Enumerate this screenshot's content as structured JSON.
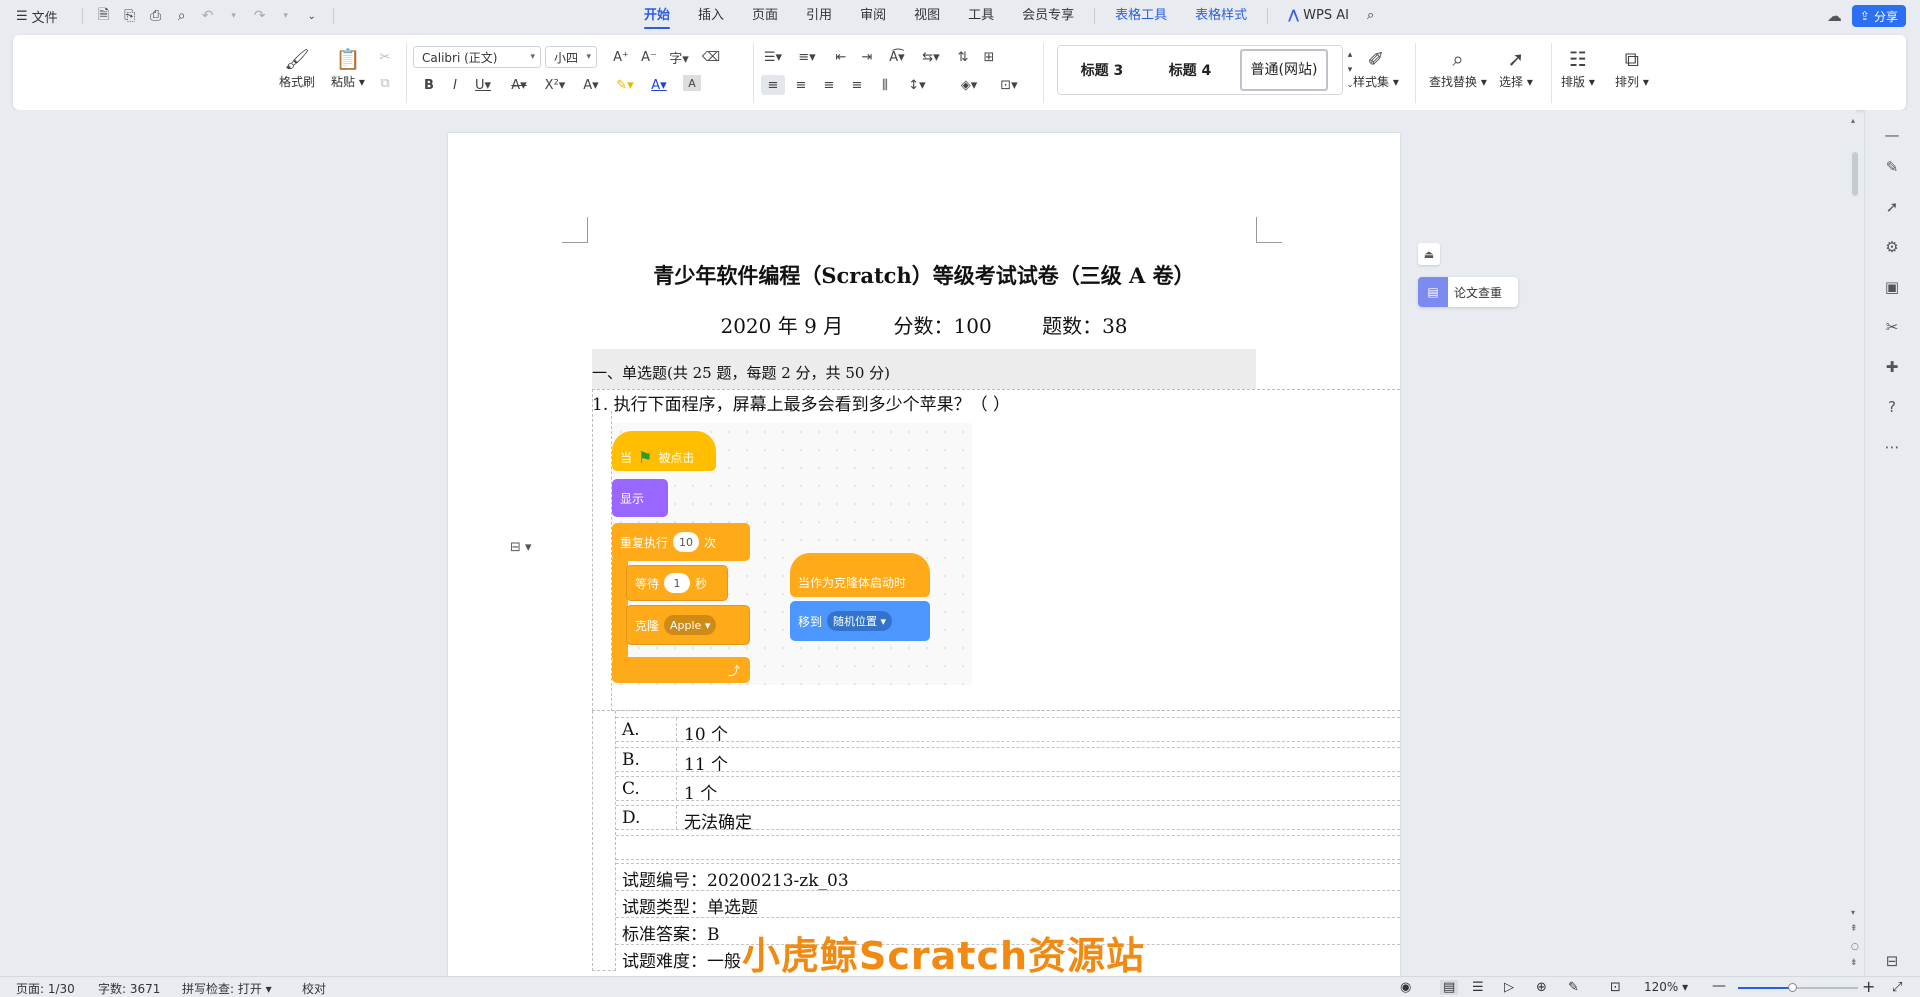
{
  "titlebar": {
    "file_label": "文件",
    "tabs": [
      {
        "label": "开始",
        "active": true
      },
      {
        "label": "插入"
      },
      {
        "label": "页面"
      },
      {
        "label": "引用"
      },
      {
        "label": "审阅"
      },
      {
        "label": "视图"
      },
      {
        "label": "工具"
      },
      {
        "label": "会员专享"
      },
      {
        "label": "表格工具",
        "contextual": true
      },
      {
        "label": "表格样式",
        "contextual": true
      }
    ],
    "wps_ai": "WPS AI",
    "share": "分享"
  },
  "ribbon": {
    "format_painter": "格式刷",
    "paste": "粘贴",
    "font_name": "Calibri (正文)",
    "font_size": "小四",
    "styles": [
      "标题 3",
      "标题 4",
      "普通(网站)"
    ],
    "style_set": "样式集",
    "find_replace": "查找替换",
    "select": "选择",
    "layout": "排版",
    "arrange": "排列"
  },
  "document": {
    "title": "青少年软件编程（Scratch）等级考试试卷（三级 A 卷）",
    "date": "2020 年 9 月",
    "score": "分数：100",
    "count": "题数：38",
    "section": "一、单选题(共 25 题，每题 2 分，共 50 分)",
    "q1": "1. 执行下面程序，屏幕上最多会看到多少个苹果？（ ）",
    "options": [
      {
        "letter": "A.",
        "text": "10 个"
      },
      {
        "letter": "B.",
        "text": "11 个"
      },
      {
        "letter": "C.",
        "text": "1 个"
      },
      {
        "letter": "D.",
        "text": "无法确定"
      }
    ],
    "meta": [
      "试题编号：20200213-zk_03",
      "试题类型：单选题",
      "标准答案：B",
      "试题难度：一般"
    ],
    "watermark": "小虎鲸Scratch资源站"
  },
  "scratch": {
    "when_flag_a": "当",
    "when_flag_b": "被点击",
    "show": "显示",
    "repeat": "重复执行",
    "repeat_count": "10",
    "repeat_unit": "次",
    "wait": "等待",
    "wait_value": "1",
    "wait_unit": "秒",
    "clone": "克隆",
    "clone_target": "Apple",
    "clone_start": "当作为克隆体启动时",
    "goto": "移到",
    "goto_target": "随机位置"
  },
  "side_panel": {
    "paper_check": "论文查重"
  },
  "statusbar": {
    "page": "页面: 1/30",
    "words": "字数: 3671",
    "spell": "拼写检查: 打开",
    "proof": "校对",
    "zoom": "120%"
  },
  "colors": {
    "accent": "#2b5ce6",
    "events": "#ffbf00",
    "looks": "#9966ff",
    "control": "#ffab19",
    "motion": "#4c97ff",
    "watermark": "#f08a12"
  }
}
